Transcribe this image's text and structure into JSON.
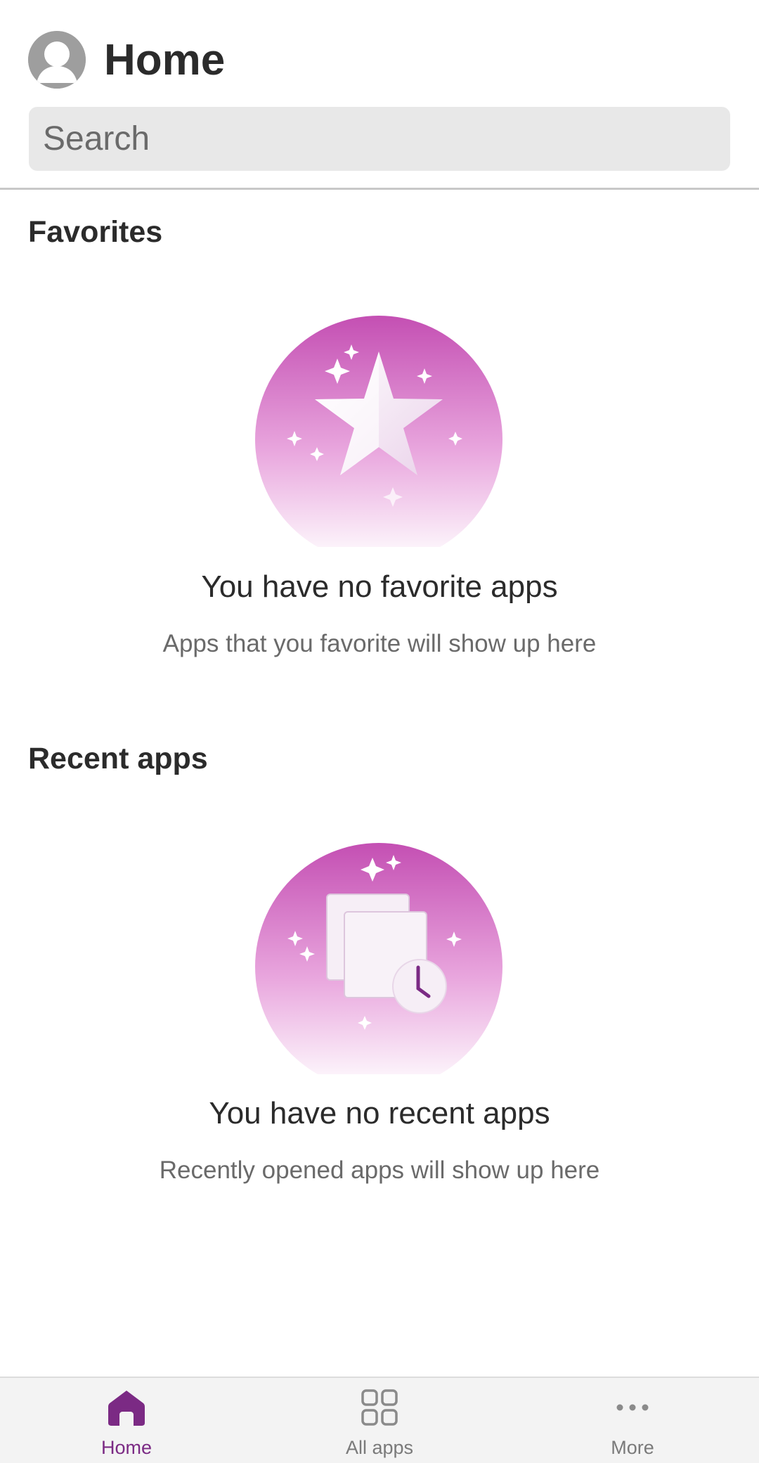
{
  "header": {
    "title": "Home",
    "search_placeholder": "Search"
  },
  "favorites": {
    "section_title": "Favorites",
    "empty_title": "You have no favorite apps",
    "empty_subtitle": "Apps that you favorite will show up here",
    "illustration_icon": "star-icon"
  },
  "recent": {
    "section_title": "Recent apps",
    "empty_title": "You have no recent apps",
    "empty_subtitle": "Recently opened apps will show up here",
    "illustration_icon": "recent-documents-clock-icon"
  },
  "tabbar": {
    "tabs": [
      {
        "label": "Home",
        "icon": "home-icon",
        "active": true
      },
      {
        "label": "All apps",
        "icon": "grid-icon",
        "active": false
      },
      {
        "label": "More",
        "icon": "more-dots-icon",
        "active": false
      }
    ]
  },
  "colors": {
    "accent": "#7b2a84",
    "illustration_top": "#c44fb3",
    "illustration_bottom": "#fbeaf8"
  }
}
